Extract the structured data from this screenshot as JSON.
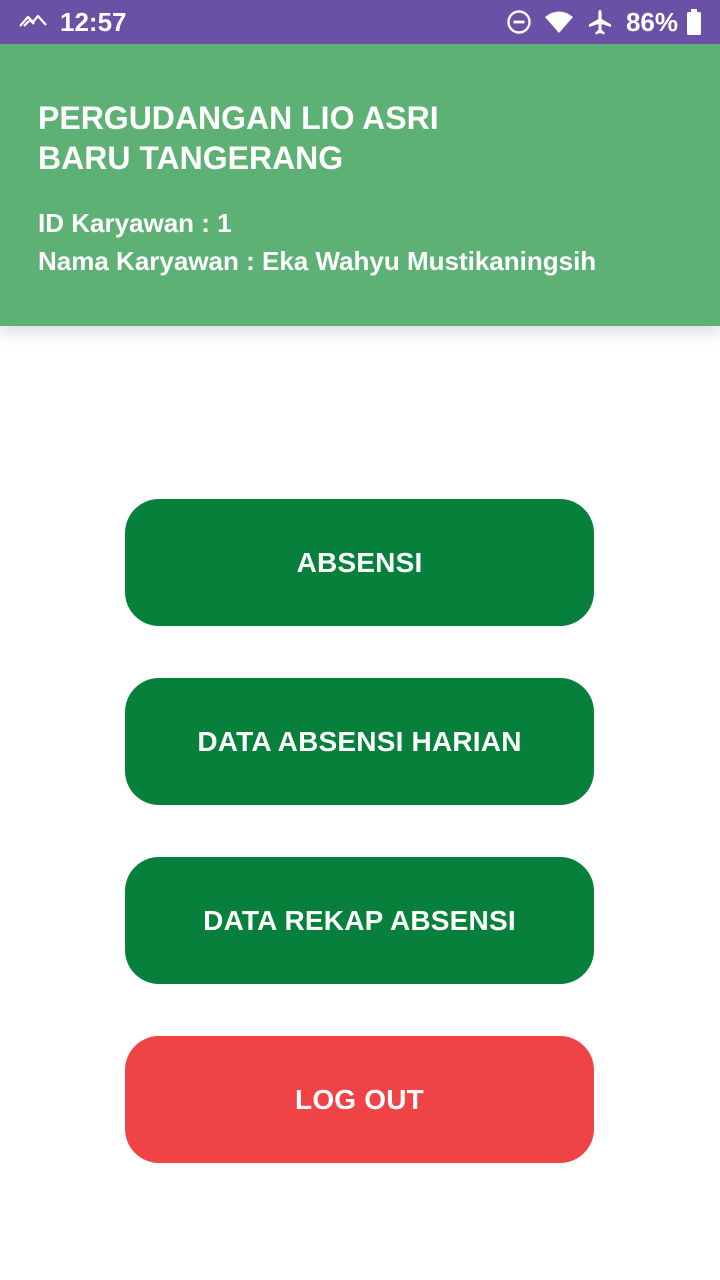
{
  "status_bar": {
    "time": "12:57",
    "battery": "86%",
    "icons": [
      "signal-icon",
      "do-not-disturb-icon",
      "wifi-icon",
      "airplane-icon",
      "battery-icon"
    ],
    "color": "#6a51a6"
  },
  "header": {
    "company_line1": "PERGUDANGAN LIO ASRI",
    "company_line2": "BARU TANGERANG",
    "employee_id": "ID Karyawan : 1",
    "employee_name": "Nama Karyawan : Eka Wahyu Mustikaningsih",
    "color": "#5db174"
  },
  "menu": {
    "absensi": "ABSENSI",
    "data_harian": "DATA ABSENSI HARIAN",
    "data_rekap": "DATA REKAP ABSENSI",
    "logout": "LOG OUT",
    "primary_color": "#06803b",
    "danger_color": "#ef4346"
  }
}
